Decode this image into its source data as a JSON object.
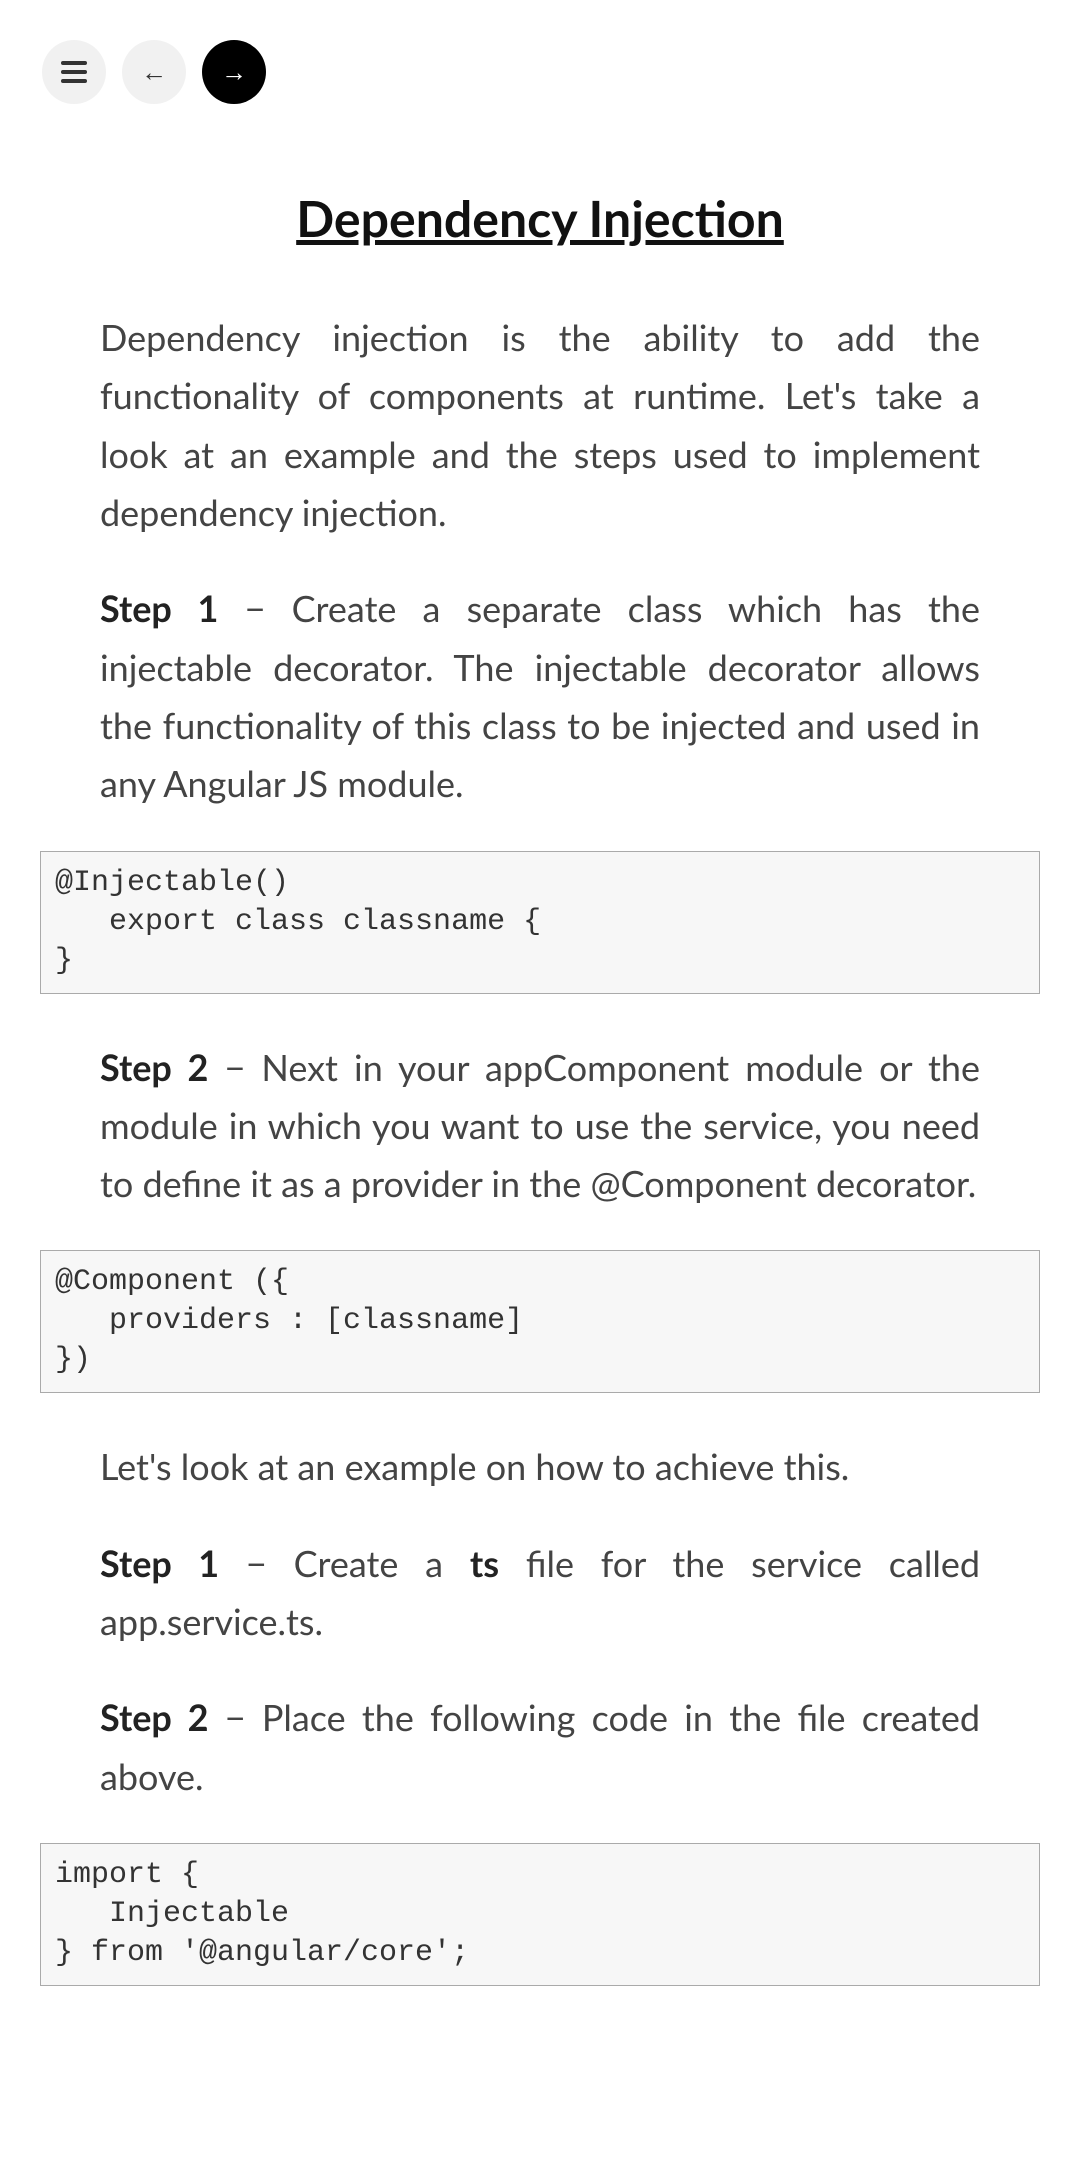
{
  "nav": {
    "menu": "menu",
    "prev": "←",
    "next": "→"
  },
  "title": "Dependency Injection",
  "intro": "Dependency injection is the ability to add the functionality of components at runtime. Let's take a look at an example and the steps used to implement dependency injection.",
  "step1": {
    "label": "Step 1",
    "text": " − Create a separate class which has the injectable decorator. The injectable decorator allows the functionality of this class to be injected and used in any Angular JS module."
  },
  "code1": "@Injectable() \n   export class classname {  \n}",
  "step2": {
    "label": "Step 2",
    "text": " − Next in your appComponent module or the module in which you want to use the service, you need to define it as a provider in the @Component decorator."
  },
  "code2": "@Component ({  \n   providers : [classname] \n})",
  "example_intro": "Let's look at an example on how to achieve this.",
  "ex_step1": {
    "label": "Step 1",
    "text_before": " − Create a ",
    "bold": "ts",
    "text_after": " file for the service called app.service.ts."
  },
  "ex_step2": {
    "label": "Step 2",
    "text": " − Place the following code in the file created above."
  },
  "code3": "import { \n   Injectable \n} from '@angular/core';"
}
